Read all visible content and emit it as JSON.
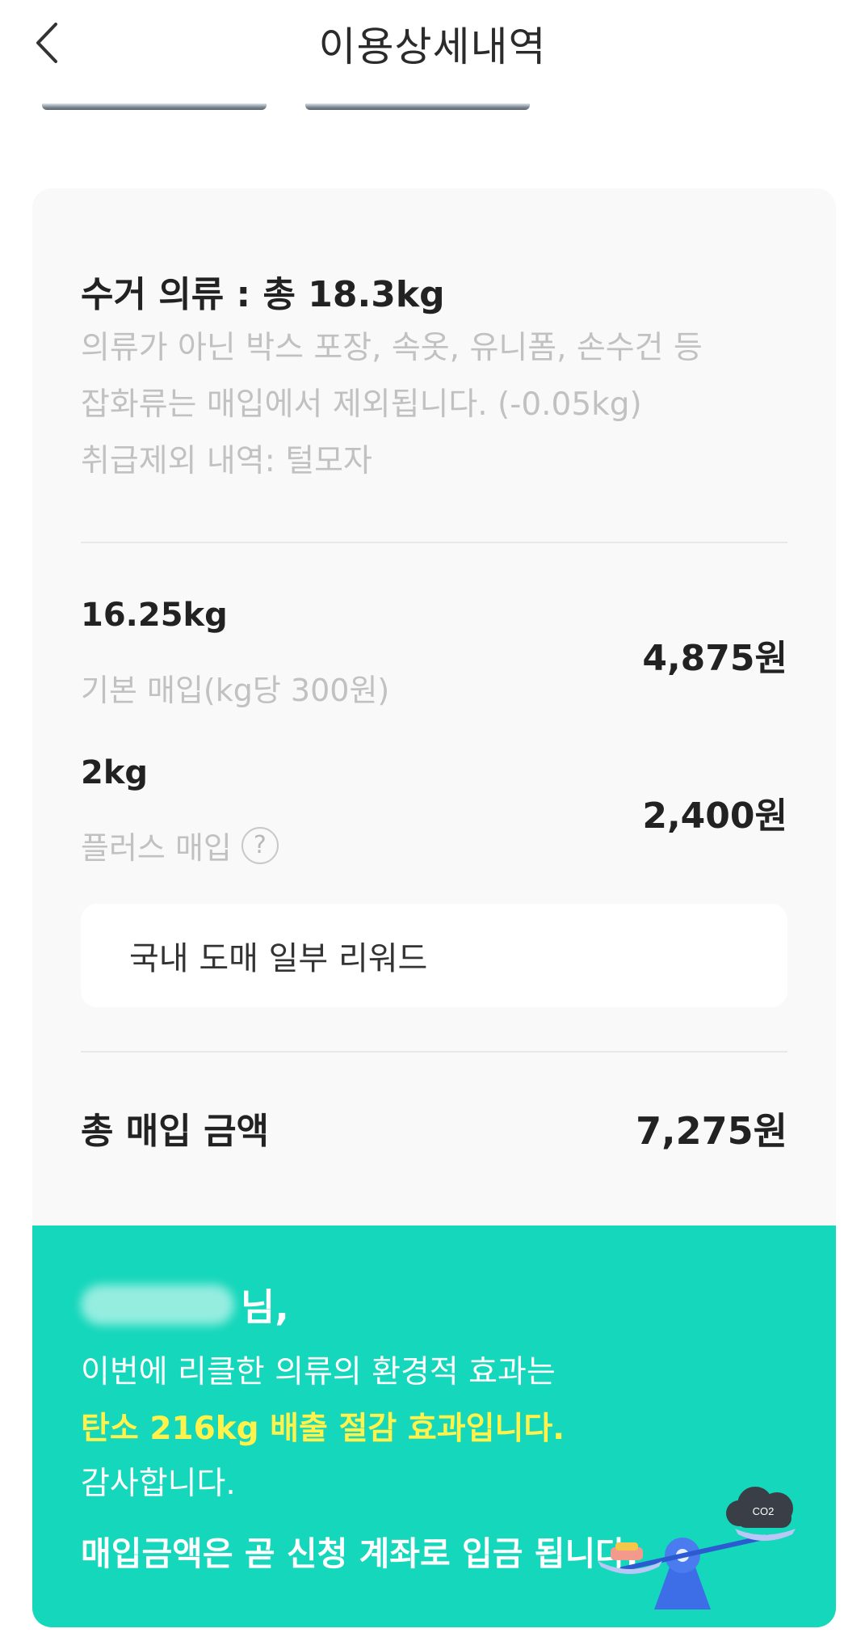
{
  "header": {
    "title": "이용상세내역"
  },
  "summary": {
    "title": "수거 의류 : 총 18.3kg",
    "description_lines": [
      "의류가 아닌 박스 포장, 속옷, 유니폼, 손수건 등",
      "잡화류는 매입에서 제외됩니다. (-0.05kg)",
      "취급제외 내역: 털모자"
    ]
  },
  "items": [
    {
      "weight": "16.25kg",
      "label": "기본 매입(kg당 300원)",
      "amount": "4,875원"
    },
    {
      "weight": "2kg",
      "label": "플러스 매입",
      "amount": "2,400원"
    }
  ],
  "help_icon_glyph": "?",
  "reward_box": {
    "text": "국내 도매 일부 리워드"
  },
  "total": {
    "label": "총 매입 금액",
    "amount": "7,275원"
  },
  "impact": {
    "name_suffix": "님,",
    "line1": "이번에 리클한 의류의 환경적 효과는",
    "line2": "탄소 216kg 배출 절감 효과입니다.",
    "line3": "감사합니다.",
    "line4": "매입금액은 곧 신청 계좌로 입금 됩니다.",
    "co2_label": "CO2"
  },
  "colors": {
    "teal": "#14d7bb",
    "highlight_yellow": "#fff24a",
    "muted_text": "#c1c1c1",
    "card_bg": "#f9f9f9"
  },
  "icons": {
    "back": "chevron-left-icon",
    "help": "question-circle-icon",
    "illustration": "scale-co2-illustration"
  }
}
